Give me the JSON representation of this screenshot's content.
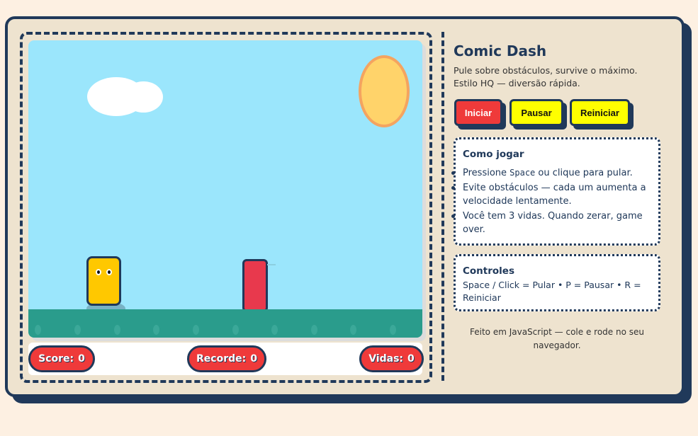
{
  "game": {
    "hud": {
      "score_label": "Score:",
      "score_value": "0",
      "record_label": "Recorde:",
      "record_value": "0",
      "lives_label": "Vidas:",
      "lives_value": "0"
    },
    "colors": {
      "sky": "#9be6fc",
      "ground": "#2a9c8c",
      "player": "#ffc800",
      "obstacle": "#e8394d",
      "sun": "#ffd36a",
      "outline": "#20395a"
    }
  },
  "sidebar": {
    "title": "Comic Dash",
    "subtitle": "Pule sobre obstáculos, survive o máximo. Estilo HQ — diversão rápida.",
    "buttons": {
      "start": "Iniciar",
      "pause": "Pausar",
      "restart": "Reiniciar"
    },
    "how_to": {
      "title": "Como jogar",
      "item1_pre": "Pressione ",
      "item1_key": "Space",
      "item1_post": " ou clique para pular.",
      "item2": "Evite obstáculos — cada um aumenta a velocidade lentamente.",
      "item3": "Você tem 3 vidas. Quando zerar, game over."
    },
    "controls": {
      "title": "Controles",
      "text": "Space / Click = Pular • P = Pausar • R = Reiniciar"
    },
    "footer": "Feito em JavaScript — cole e rode no seu navegador."
  }
}
